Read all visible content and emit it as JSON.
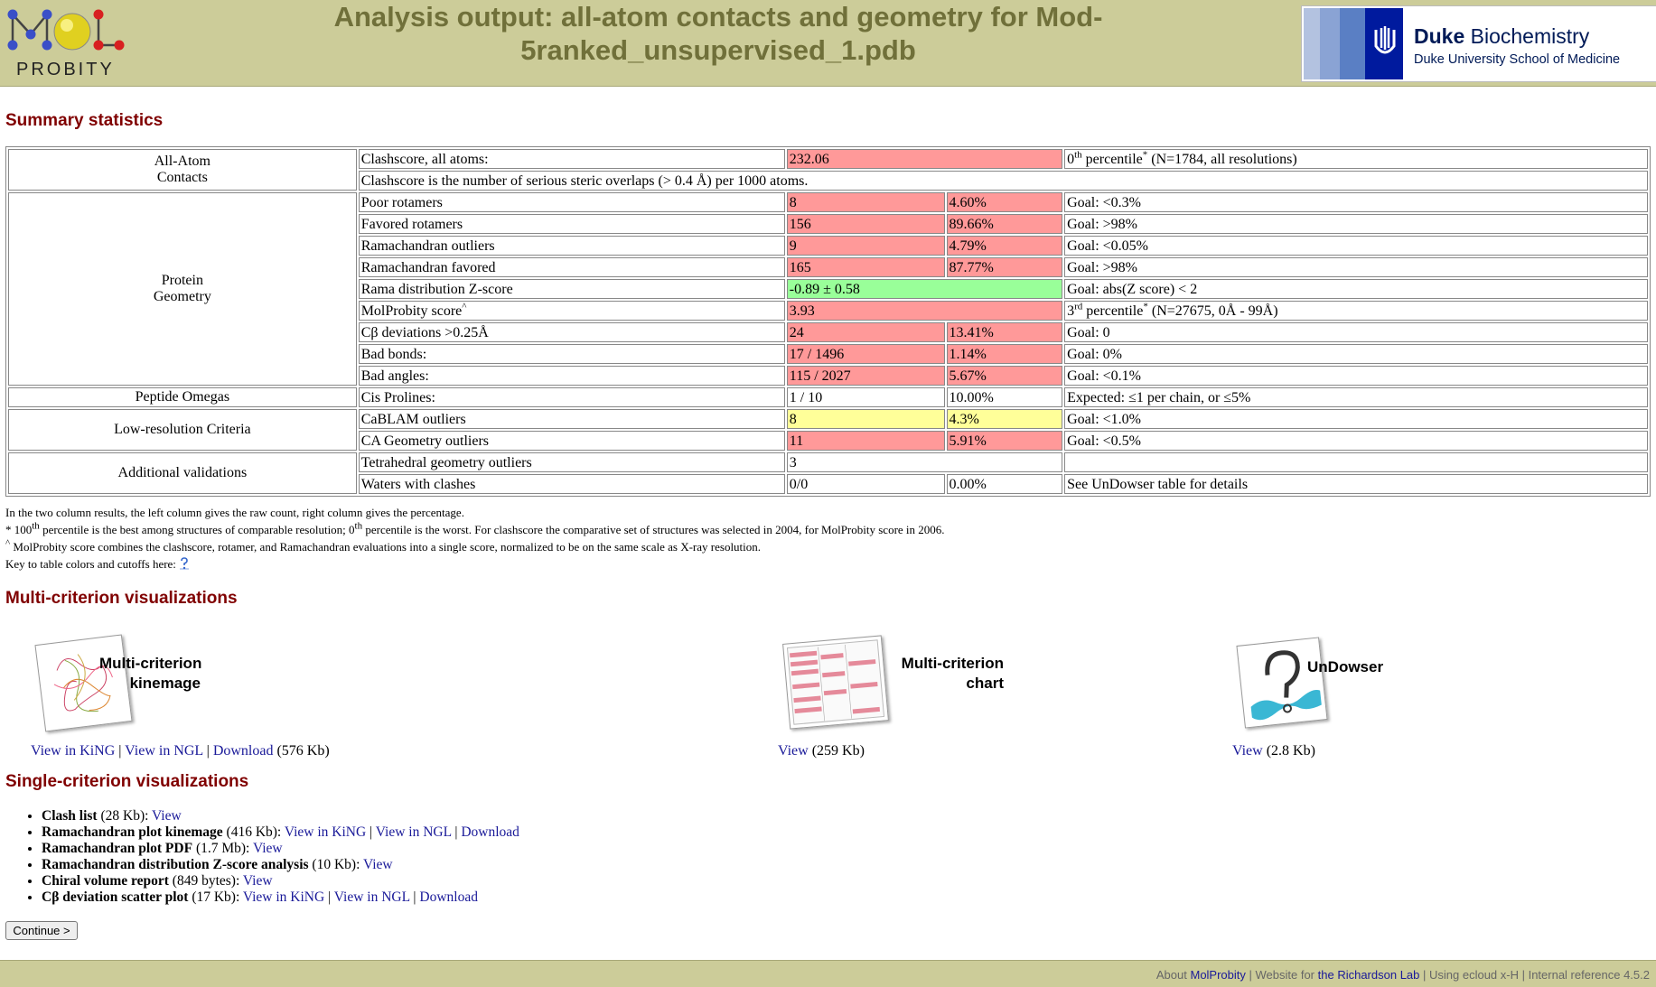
{
  "header": {
    "logo_text": "PROBITY",
    "title": "Analysis output: all-atom contacts and geometry for Mod-5ranked_unsupervised_1.pdb",
    "duke_name_bold": "Duke",
    "duke_name_rest": " Biochemistry",
    "duke_sub": "Duke University School of Medicine"
  },
  "summary": {
    "heading": "Summary statistics",
    "rows": [
      {
        "cat": "All-Atom\nContacts",
        "label": "Clashscore, all atoms:",
        "v1": "232.06",
        "c1": "red",
        "span": true,
        "goal_pre": "0",
        "goal_sup": "th",
        "goal_mid": " percentile",
        "goal_ast": "*",
        "goal_post": " (N=1784, all resolutions)"
      },
      {
        "label": "Clashscore is the number of serious steric overlaps (> 0.4 Å) per 1000 atoms.",
        "fullrow": true
      },
      {
        "cat": "Protein\nGeometry",
        "label": "Poor rotamers",
        "v1": "8",
        "v2": "4.60%",
        "c1": "red",
        "c2": "red",
        "goal": "Goal: <0.3%"
      },
      {
        "label": "Favored rotamers",
        "v1": "156",
        "v2": "89.66%",
        "c1": "red",
        "c2": "red",
        "goal": "Goal: >98%"
      },
      {
        "label": "Ramachandran outliers",
        "v1": "9",
        "v2": "4.79%",
        "c1": "red",
        "c2": "red",
        "goal": "Goal: <0.05%"
      },
      {
        "label": "Ramachandran favored",
        "v1": "165",
        "v2": "87.77%",
        "c1": "red",
        "c2": "red",
        "goal": "Goal: >98%"
      },
      {
        "label": "Rama distribution Z-score",
        "v1": "-0.89 ± 0.58",
        "c1": "green",
        "span": true,
        "goal": "Goal: abs(Z score) < 2"
      },
      {
        "label": "MolProbity score",
        "label_sup": "^",
        "v1": "3.93",
        "c1": "red",
        "span": true,
        "goal_pre": "3",
        "goal_sup": "rd",
        "goal_mid": " percentile",
        "goal_ast": "*",
        "goal_post": " (N=27675, 0Å - 99Å)"
      },
      {
        "label": "Cβ deviations >0.25Å",
        "v1": "24",
        "v2": "13.41%",
        "c1": "red",
        "c2": "red",
        "goal": "Goal: 0"
      },
      {
        "label": "Bad bonds:",
        "v1": "17 / 1496",
        "v2": "1.14%",
        "c1": "red",
        "c2": "red",
        "goal": "Goal: 0%"
      },
      {
        "label": "Bad angles:",
        "v1": "115 / 2027",
        "v2": "5.67%",
        "c1": "red",
        "c2": "red",
        "goal": "Goal: <0.1%"
      },
      {
        "cat": "Peptide Omegas",
        "label": "Cis Prolines:",
        "v1": "1 / 10",
        "v2": "10.00%",
        "c1": "",
        "c2": "",
        "goal": "Expected: ≤1 per chain, or ≤5%"
      },
      {
        "cat": "Low-resolution Criteria",
        "label": "CaBLAM outliers",
        "v1": "8",
        "v2": "4.3%",
        "c1": "yellow",
        "c2": "yellow",
        "goal": "Goal: <1.0%"
      },
      {
        "label": "CA Geometry outliers",
        "v1": "11",
        "v2": "5.91%",
        "c1": "red",
        "c2": "red",
        "goal": "Goal: <0.5%"
      },
      {
        "cat": "Additional validations",
        "label": "Tetrahedral geometry outliers",
        "v1": "3",
        "c1": "",
        "span": true,
        "goal": ""
      },
      {
        "label": "Waters with clashes",
        "v1": "0/0",
        "v2": "0.00%",
        "c1": "",
        "c2": "",
        "goal": "See UnDowser table for details"
      }
    ],
    "notes": {
      "n1": "In the two column results, the left column gives the raw count, right column gives the percentage.",
      "n2_a": "* 100",
      "n2_sup1": "th",
      "n2_b": " percentile is the best among structures of comparable resolution; 0",
      "n2_sup2": "th",
      "n2_c": " percentile is the worst. For clashscore the comparative set of structures was selected in 2004, for MolProbity score in 2006.",
      "n3_sup": "^",
      "n3": " MolProbity score combines the clashscore, rotamer, and Ramachandran evaluations into a single score, normalized to be on the same scale as X-ray resolution.",
      "n4": "Key to table colors and cutoffs here: "
    }
  },
  "multi": {
    "heading": "Multi-criterion visualizations",
    "kinemage": {
      "title1": "Multi-criterion",
      "title2": "kinemage",
      "link1": "View in KiNG",
      "sep1": " | ",
      "link2": "View in NGL",
      "sep2": " | ",
      "link3": "Download",
      "size": " (576 Kb)"
    },
    "chart": {
      "title1": "Multi-criterion",
      "title2": "chart",
      "link1": "View",
      "size": " (259 Kb)"
    },
    "undowser": {
      "title1": "UnDowser",
      "link1": "View",
      "size": " (2.8 Kb)"
    }
  },
  "single": {
    "heading": "Single-criterion visualizations",
    "items": [
      {
        "name": "Clash list",
        "size": " (28 Kb): ",
        "links": [
          "View"
        ]
      },
      {
        "name": "Ramachandran plot kinemage",
        "size": " (416 Kb): ",
        "links": [
          "View in KiNG",
          "View in NGL",
          "Download"
        ]
      },
      {
        "name": "Ramachandran plot PDF",
        "size": " (1.7 Mb): ",
        "links": [
          "View"
        ]
      },
      {
        "name": "Ramachandran distribution Z-score analysis",
        "size": " (10 Kb): ",
        "links": [
          "View"
        ]
      },
      {
        "name": "Chiral volume report",
        "size": " (849 bytes): ",
        "links": [
          "View"
        ]
      },
      {
        "name": "Cβ deviation scatter plot",
        "size": " (17 Kb): ",
        "links": [
          "View in KiNG",
          "View in NGL",
          "Download"
        ]
      }
    ],
    "continue_label": "Continue >"
  },
  "footer": {
    "about": "About ",
    "molprobity": "MolProbity",
    "website": " | Website for ",
    "richardson": "the Richardson Lab",
    "rest": " | Using ecloud x-H | Internal reference 4.5.2"
  },
  "colors": {
    "header_bg": "#cccc99",
    "title": "#70703a",
    "heading": "#800000",
    "bad": "#ff9999",
    "warn": "#ffff99",
    "good": "#99ff99",
    "link": "#1a1a99"
  }
}
